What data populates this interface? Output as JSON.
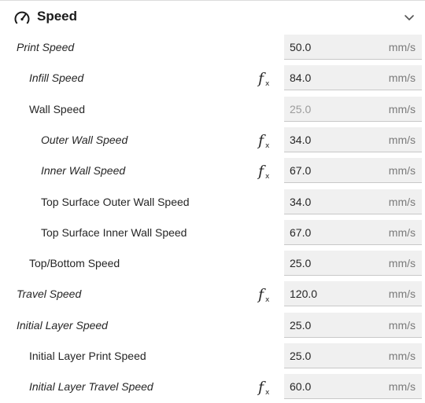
{
  "section": {
    "title": "Speed",
    "icon": "speedometer-icon",
    "collapse_icon": "chevron-down-icon"
  },
  "fx_icon": "formula-fx-icon",
  "unit": "mm/s",
  "rows": [
    {
      "label": "Print Speed",
      "value": "50.0",
      "italic": true,
      "indent": 0,
      "fx": false,
      "disabled": false
    },
    {
      "label": "Infill Speed",
      "value": "84.0",
      "italic": true,
      "indent": 1,
      "fx": true,
      "disabled": false
    },
    {
      "label": "Wall Speed",
      "value": "25.0",
      "italic": false,
      "indent": 1,
      "fx": false,
      "disabled": true
    },
    {
      "label": "Outer Wall Speed",
      "value": "34.0",
      "italic": true,
      "indent": 2,
      "fx": true,
      "disabled": false
    },
    {
      "label": "Inner Wall Speed",
      "value": "67.0",
      "italic": true,
      "indent": 2,
      "fx": true,
      "disabled": false
    },
    {
      "label": "Top Surface Outer Wall Speed",
      "value": "34.0",
      "italic": false,
      "indent": 2,
      "fx": false,
      "disabled": false
    },
    {
      "label": "Top Surface Inner Wall Speed",
      "value": "67.0",
      "italic": false,
      "indent": 2,
      "fx": false,
      "disabled": false
    },
    {
      "label": "Top/Bottom Speed",
      "value": "25.0",
      "italic": false,
      "indent": 1,
      "fx": false,
      "disabled": false
    },
    {
      "label": "Travel Speed",
      "value": "120.0",
      "italic": true,
      "indent": 0,
      "fx": true,
      "disabled": false
    },
    {
      "label": "Initial Layer Speed",
      "value": "25.0",
      "italic": true,
      "indent": 0,
      "fx": false,
      "disabled": false
    },
    {
      "label": "Initial Layer Print Speed",
      "value": "25.0",
      "italic": false,
      "indent": 1,
      "fx": false,
      "disabled": false
    },
    {
      "label": "Initial Layer Travel Speed",
      "value": "60.0",
      "italic": true,
      "indent": 1,
      "fx": true,
      "disabled": false
    }
  ]
}
